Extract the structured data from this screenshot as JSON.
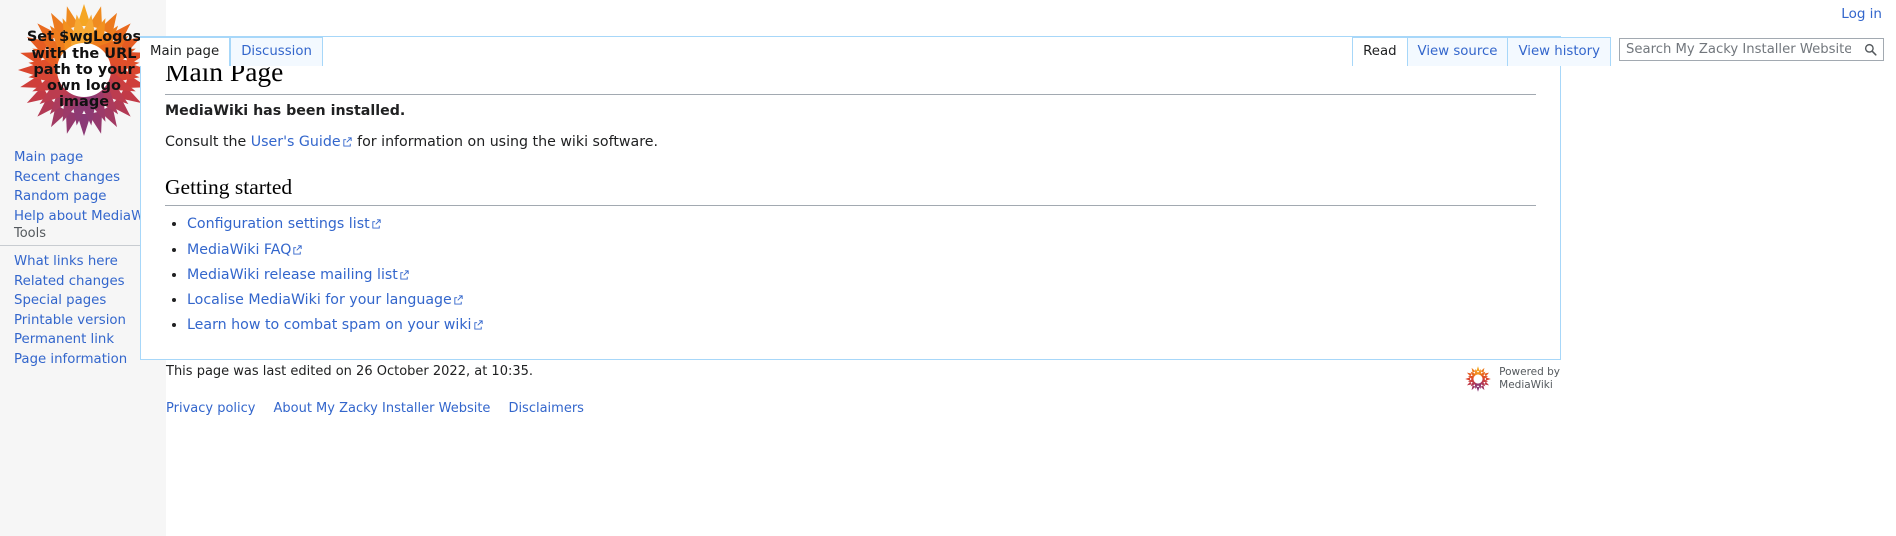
{
  "site": {
    "name": "My Zacky Installer Website",
    "logo_text": "Set $wgLogos with the URL path to your own logo image"
  },
  "personal_bar": {
    "login_label": "Log in"
  },
  "namespace_tabs": [
    {
      "label": "Main page",
      "selected": true
    },
    {
      "label": "Discussion",
      "selected": false
    }
  ],
  "action_tabs": [
    {
      "label": "Read",
      "selected": true
    },
    {
      "label": "View source",
      "selected": false
    },
    {
      "label": "View history",
      "selected": false
    }
  ],
  "search": {
    "placeholder": "Search My Zacky Installer Website",
    "value": "",
    "icon": "search-icon",
    "button_label": "Search"
  },
  "sidebar": {
    "navigation": {
      "heading": "",
      "items": [
        {
          "label": "Main page"
        },
        {
          "label": "Recent changes"
        },
        {
          "label": "Random page"
        },
        {
          "label": "Help about MediaWiki"
        }
      ]
    },
    "tools": {
      "heading": "Tools",
      "items": [
        {
          "label": "What links here"
        },
        {
          "label": "Related changes"
        },
        {
          "label": "Special pages"
        },
        {
          "label": "Printable version"
        },
        {
          "label": "Permanent link"
        },
        {
          "label": "Page information"
        }
      ]
    }
  },
  "main": {
    "title": "Main Page",
    "installed_notice": "MediaWiki has been installed.",
    "consult": {
      "before": "Consult the ",
      "link": "User's Guide",
      "after": " for information on using the wiki software."
    },
    "getting_started_heading": "Getting started",
    "getting_started_links": [
      {
        "label": "Configuration settings list"
      },
      {
        "label": "MediaWiki FAQ"
      },
      {
        "label": "MediaWiki release mailing list"
      },
      {
        "label": "Localise MediaWiki for your language"
      },
      {
        "label": "Learn how to combat spam on your wiki"
      }
    ]
  },
  "footer": {
    "lastmod": "This page was last edited on 26 October 2022, at 10:35.",
    "places": [
      {
        "label": "Privacy policy"
      },
      {
        "label": "About My Zacky Installer Website"
      },
      {
        "label": "Disclaimers"
      }
    ],
    "poweredby_line1": "Powered by",
    "poweredby_line2": "MediaWiki"
  },
  "colors": {
    "link": "#3366cc",
    "tab_border": "#a7d7f9",
    "tab_inactive_bg": "#f3f9ff",
    "sidebar_bg": "#f6f6f6",
    "text": "#202122"
  }
}
